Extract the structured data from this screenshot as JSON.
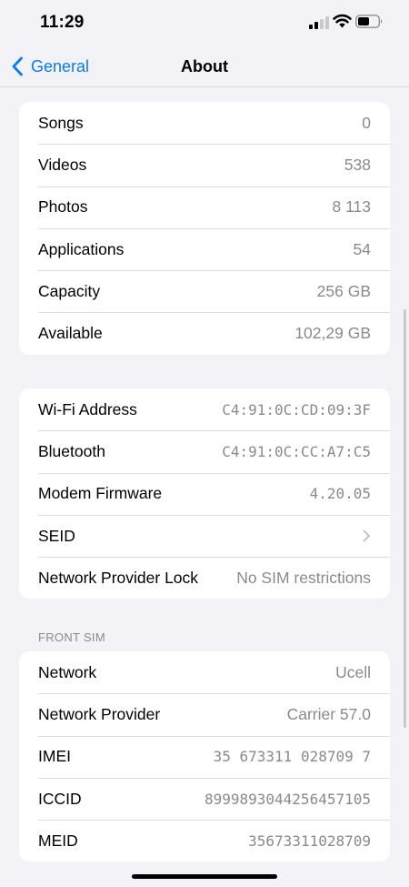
{
  "status_bar": {
    "time": "11:29",
    "icons": [
      "signal-icon",
      "wifi-icon",
      "battery-icon"
    ]
  },
  "nav": {
    "back_label": "General",
    "title": "About"
  },
  "media_group": [
    {
      "label": "Songs",
      "value": "0"
    },
    {
      "label": "Videos",
      "value": "538"
    },
    {
      "label": "Photos",
      "value": "8 113"
    },
    {
      "label": "Applications",
      "value": "54"
    },
    {
      "label": "Capacity",
      "value": "256 GB"
    },
    {
      "label": "Available",
      "value": "102,29 GB"
    }
  ],
  "network_group": [
    {
      "label": "Wi-Fi Address",
      "value": "C4:91:0C:CD:09:3F"
    },
    {
      "label": "Bluetooth",
      "value": "C4:91:0C:CC:A7:C5"
    },
    {
      "label": "Modem Firmware",
      "value": "4.20.05"
    },
    {
      "label": "SEID",
      "value": ""
    },
    {
      "label": "Network Provider Lock",
      "value": "No SIM restrictions"
    }
  ],
  "sim_section": {
    "header": "FRONT SIM",
    "rows": [
      {
        "label": "Network",
        "value": "Ucell"
      },
      {
        "label": "Network Provider",
        "value": "Carrier 57.0"
      },
      {
        "label": "IMEI",
        "value": "35 673311 028709 7"
      },
      {
        "label": "ICCID",
        "value": "8999893044256457105"
      },
      {
        "label": "MEID",
        "value": "35673311028709"
      }
    ]
  },
  "colors": {
    "accent": "#0a7aff",
    "background": "#f2f2f7",
    "secondary_text": "#8a8a8e"
  }
}
